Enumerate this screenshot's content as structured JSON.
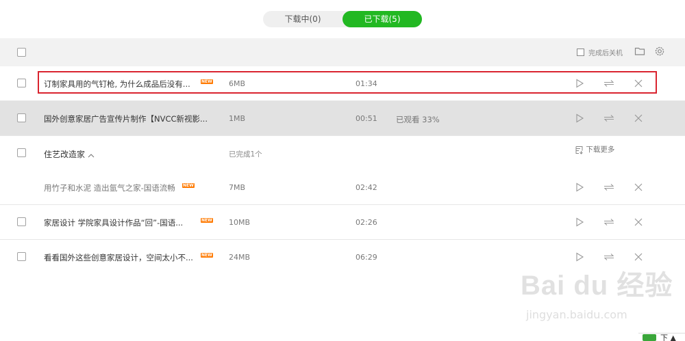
{
  "tabs": {
    "downloading": "下载中(0)",
    "downloaded": "已下载(5)"
  },
  "toolbar": {
    "shutdown_label": "完成后关机"
  },
  "rows": [
    {
      "title": "订制家具用的气钉枪, 为什么成品后没有...",
      "badge": "NEW",
      "size": "6MB",
      "duration": "01:34"
    },
    {
      "title": "国外创意家居广告宣传片制作【NVCC新视影...",
      "size": "1MB",
      "duration": "00:51",
      "watched": "已观看 33%"
    },
    {
      "title": "住艺改造家",
      "status": "已完成1个",
      "more": "下载更多"
    },
    {
      "title": "用竹子和水泥 造出氩气之家-国语流畅",
      "badge": "NEW",
      "size": "7MB",
      "duration": "02:42"
    },
    {
      "title": "家居设计 学院家具设计作品“回”-国语...",
      "badge": "NEW",
      "size": "10MB",
      "duration": "02:26"
    },
    {
      "title": "看看国外这些创意家居设计，空间太小不...",
      "badge": "NEW",
      "size": "24MB",
      "duration": "06:29"
    }
  ],
  "watermark": {
    "logo": "Bai du 经验",
    "url": "jingyan.baidu.com"
  },
  "corner": {
    "text": "下 ▲"
  },
  "colors": {
    "accent": "#22b822",
    "highlight": "#d9232e",
    "badge": "#ff7a00"
  }
}
